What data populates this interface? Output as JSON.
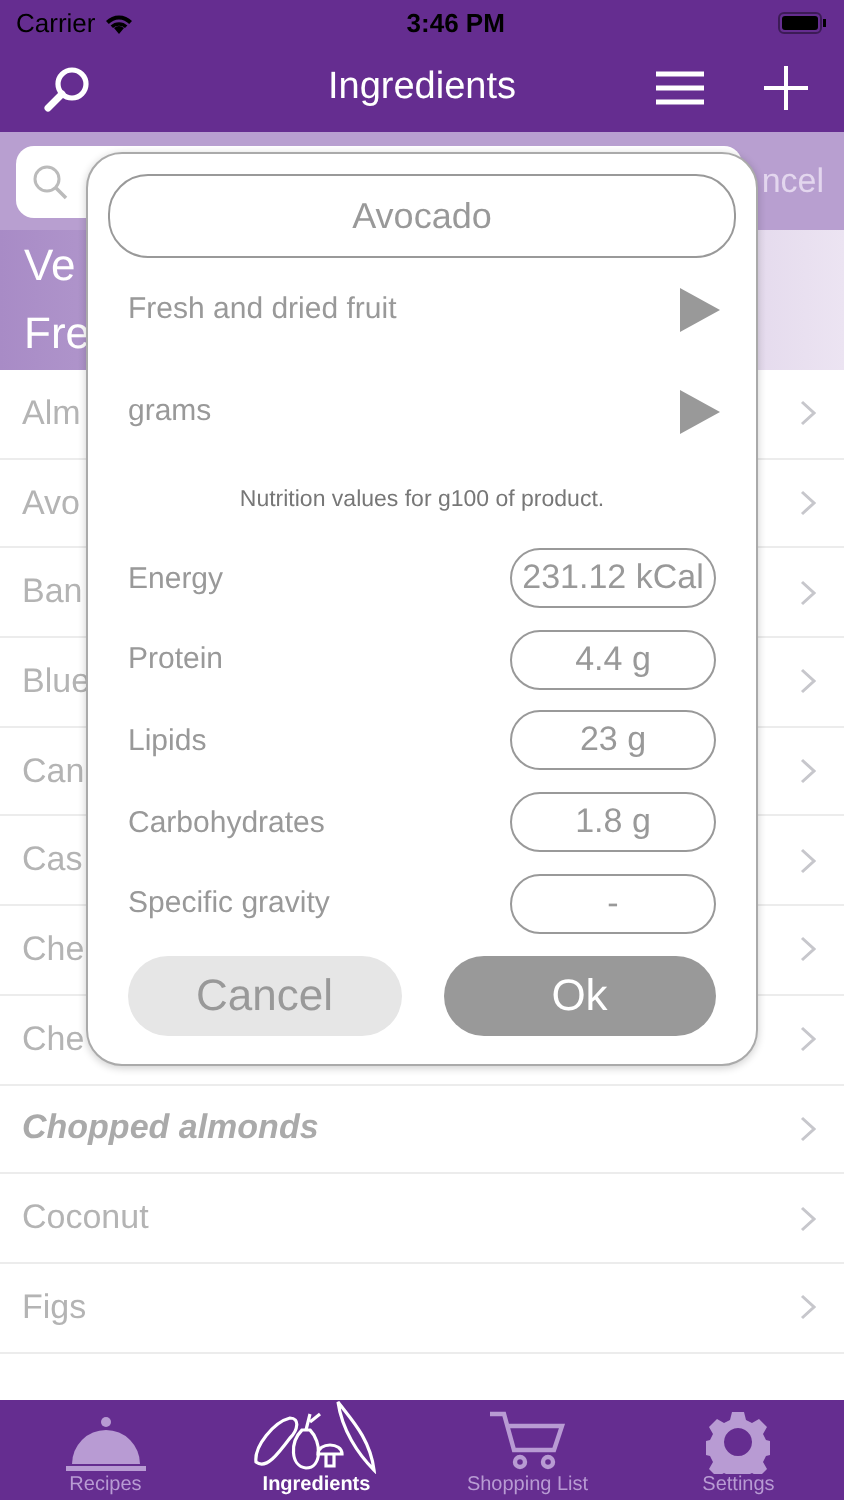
{
  "status_bar": {
    "carrier": "Carrier",
    "time": "3:46 PM"
  },
  "nav": {
    "title": "Ingredients"
  },
  "search": {
    "cancel": "ncel"
  },
  "section": {
    "title": "Ve",
    "subtitle": "Fre"
  },
  "rows": [
    {
      "label": "Alm",
      "kind": "plain"
    },
    {
      "label": "Avo",
      "kind": "plain"
    },
    {
      "label": "Ban",
      "kind": "plain"
    },
    {
      "label": "Blue",
      "kind": "plain"
    },
    {
      "label": "Can",
      "kind": "plain"
    },
    {
      "label": "Cas",
      "kind": "plain"
    },
    {
      "label": "Che",
      "kind": "plain"
    },
    {
      "label": "Che",
      "kind": "plain"
    },
    {
      "label": "Chopped almonds",
      "kind": "composite"
    },
    {
      "label": "Coconut",
      "kind": "plain"
    },
    {
      "label": "Figs",
      "kind": "plain"
    }
  ],
  "dialog": {
    "name": "Avocado",
    "pickers": [
      {
        "label": "Fresh and dried fruit"
      },
      {
        "label": "grams"
      }
    ],
    "note": "Nutrition values for g100 of product.",
    "values": [
      {
        "label": "Energy",
        "value": "231.12 kCal"
      },
      {
        "label": "Protein",
        "value": "4.4 g"
      },
      {
        "label": "Lipids",
        "value": "23 g"
      },
      {
        "label": "Carbohydrates",
        "value": "1.8 g"
      },
      {
        "label": "Specific gravity",
        "value": "-"
      }
    ],
    "buttons": [
      {
        "label": "Cancel",
        "kind": "secondary"
      },
      {
        "label": "Ok",
        "kind": "primary"
      }
    ]
  },
  "tabs": [
    {
      "label": "Recipes",
      "selected": false
    },
    {
      "label": "Ingredients",
      "selected": true
    },
    {
      "label": "Shopping List",
      "selected": false
    },
    {
      "label": "Settings",
      "selected": false
    }
  ]
}
